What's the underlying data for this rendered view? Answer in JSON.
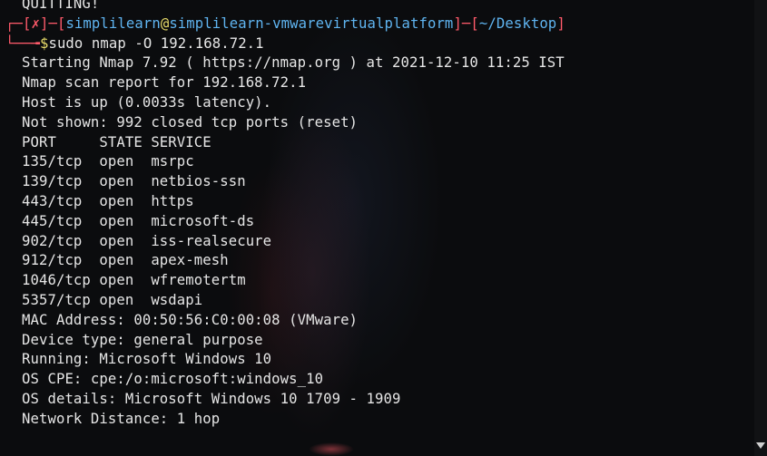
{
  "terminal": {
    "top_line": "QUITTING!",
    "prompt": {
      "open_bracket": "┌─[",
      "x_mark": "✗",
      "mid": "]─[",
      "user": "simplilearn",
      "at": "@",
      "host": "simplilearn-vmwarevirtualplatform",
      "sep": "]─[",
      "path": "~/Desktop",
      "close": "]",
      "corner": "└──╼",
      "dollar": "$",
      "command": "sudo nmap -O 192.168.72.1"
    },
    "output": [
      "Starting Nmap 7.92 ( https://nmap.org ) at 2021-12-10 11:25 IST",
      "Nmap scan report for 192.168.72.1",
      "Host is up (0.0033s latency).",
      "Not shown: 992 closed tcp ports (reset)",
      "PORT     STATE SERVICE",
      "135/tcp  open  msrpc",
      "139/tcp  open  netbios-ssn",
      "443/tcp  open  https",
      "445/tcp  open  microsoft-ds",
      "902/tcp  open  iss-realsecure",
      "912/tcp  open  apex-mesh",
      "1046/tcp open  wfremotertm",
      "5357/tcp open  wsdapi",
      "MAC Address: 00:50:56:C0:00:08 (VMware)",
      "Device type: general purpose",
      "Running: Microsoft Windows 10",
      "OS CPE: cpe:/o:microsoft:windows_10",
      "OS details: Microsoft Windows 10 1709 - 1909",
      "Network Distance: 1 hop"
    ]
  },
  "colors": {
    "background": "#0b0c0e",
    "text": "#e6e6e6",
    "prompt_red": "#ff5a6a",
    "prompt_blue": "#5fb4f0",
    "prompt_yellow": "#e8dc6a"
  }
}
